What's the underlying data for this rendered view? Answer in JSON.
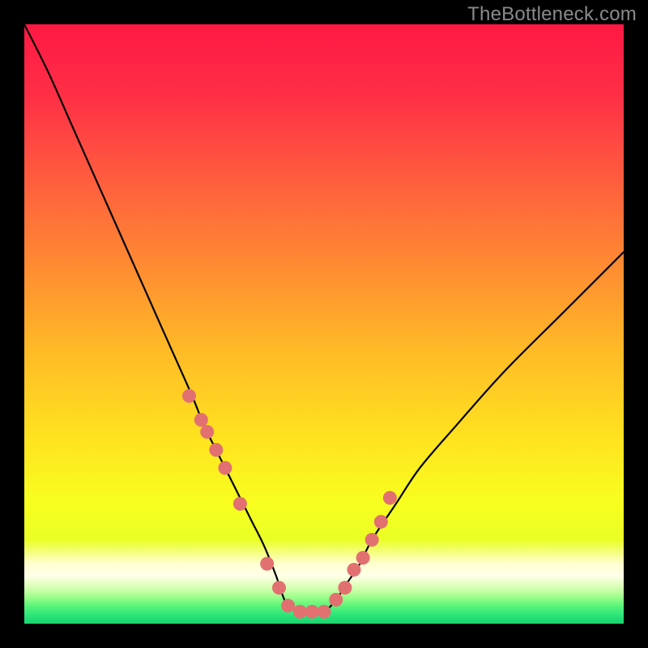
{
  "watermark": "TheBottleneck.com",
  "chart_data": {
    "type": "line",
    "title": "",
    "xlabel": "",
    "ylabel": "",
    "xlim": [
      0,
      100
    ],
    "ylim": [
      0,
      100
    ],
    "grid": false,
    "legend": false,
    "series": [
      {
        "name": "bottleneck-curve",
        "x": [
          0,
          4,
          8,
          12,
          16,
          20,
          24,
          28,
          30,
          32,
          34,
          36,
          38,
          40,
          42,
          43,
          44,
          46,
          48,
          50,
          52,
          54,
          56,
          58,
          62,
          66,
          72,
          80,
          90,
          100
        ],
        "values": [
          100,
          92,
          83,
          74,
          65,
          56,
          47,
          38,
          33,
          29,
          25,
          21,
          17,
          13,
          8,
          5,
          3,
          2,
          2,
          2,
          4,
          7,
          10,
          14,
          20,
          26,
          33,
          42,
          52,
          62
        ]
      }
    ],
    "markers": {
      "name": "highlighted-points",
      "color": "#e27070",
      "x": [
        27.5,
        29.5,
        30.5,
        32.0,
        33.5,
        36.0,
        40.5,
        42.5,
        44.0,
        46.0,
        48.0,
        50.0,
        52.0,
        53.5,
        55.0,
        56.5,
        58.0,
        59.5,
        61.0
      ],
      "values": [
        38,
        34,
        32,
        29,
        26,
        20,
        10,
        6,
        3,
        2,
        2,
        2,
        4,
        6,
        9,
        11,
        14,
        17,
        21
      ]
    },
    "gradient_stops": [
      {
        "pos": 0.0,
        "color": "#ff1844"
      },
      {
        "pos": 0.12,
        "color": "#ff2f46"
      },
      {
        "pos": 0.25,
        "color": "#ff5a3f"
      },
      {
        "pos": 0.4,
        "color": "#ff8a32"
      },
      {
        "pos": 0.55,
        "color": "#ffbc26"
      },
      {
        "pos": 0.7,
        "color": "#ffe51f"
      },
      {
        "pos": 0.8,
        "color": "#f7ff1f"
      },
      {
        "pos": 0.86,
        "color": "#eaff25"
      },
      {
        "pos": 0.9,
        "color": "#ffffd0"
      },
      {
        "pos": 0.92,
        "color": "#ffffe8"
      },
      {
        "pos": 0.94,
        "color": "#d6ffb0"
      },
      {
        "pos": 0.955,
        "color": "#9fff8c"
      },
      {
        "pos": 0.97,
        "color": "#5cf57a"
      },
      {
        "pos": 0.985,
        "color": "#2de57a"
      },
      {
        "pos": 1.0,
        "color": "#18d46e"
      }
    ]
  }
}
